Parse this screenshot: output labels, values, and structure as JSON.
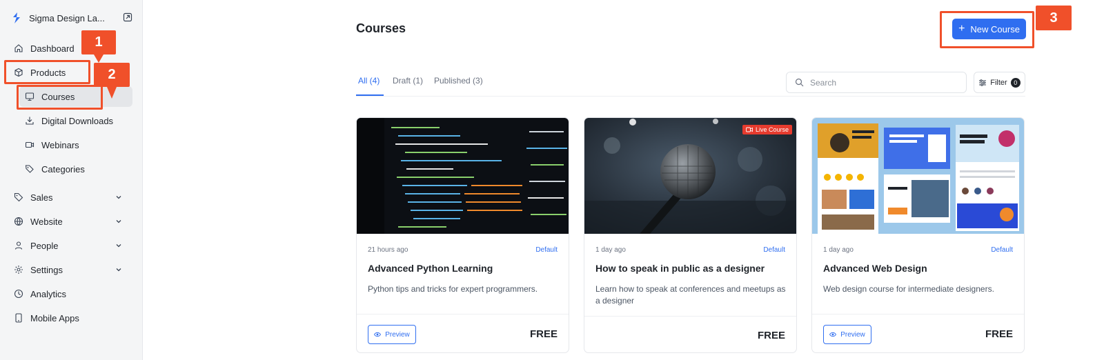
{
  "sidebar": {
    "brand": "Sigma Design La...",
    "items": [
      {
        "label": "Dashboard"
      },
      {
        "label": "Products"
      },
      {
        "label": "Courses"
      },
      {
        "label": "Digital Downloads"
      },
      {
        "label": "Webinars"
      },
      {
        "label": "Categories"
      },
      {
        "label": "Sales"
      },
      {
        "label": "Website"
      },
      {
        "label": "People"
      },
      {
        "label": "Settings"
      },
      {
        "label": "Analytics"
      },
      {
        "label": "Mobile Apps"
      }
    ]
  },
  "callouts": [
    "1",
    "2",
    "3"
  ],
  "header": {
    "title": "Courses",
    "new_course_label": "New Course"
  },
  "tabs": [
    {
      "label": "All (4)"
    },
    {
      "label": "Draft (1)"
    },
    {
      "label": "Published (3)"
    }
  ],
  "search": {
    "placeholder": "Search"
  },
  "filter": {
    "label": "Filter",
    "count": "0"
  },
  "courses": [
    {
      "time": "21 hours ago",
      "tag": "Default",
      "title": "Advanced Python Learning",
      "description": "Python tips and tricks for expert programmers.",
      "preview_label": "Preview",
      "price": "FREE"
    },
    {
      "time": "1 day ago",
      "tag": "Default",
      "title": "How to speak in public as a designer",
      "description": "Learn how to speak at conferences and meetups as a designer",
      "price": "FREE",
      "live_label": "Live Course"
    },
    {
      "time": "1 day ago",
      "tag": "Default",
      "title": "Advanced Web Design",
      "description": "Web design course for intermediate designers.",
      "preview_label": "Preview",
      "price": "FREE"
    }
  ],
  "colors": {
    "accent": "#2f6ef0",
    "callout": "#f0502a",
    "live": "#e63b2e"
  }
}
